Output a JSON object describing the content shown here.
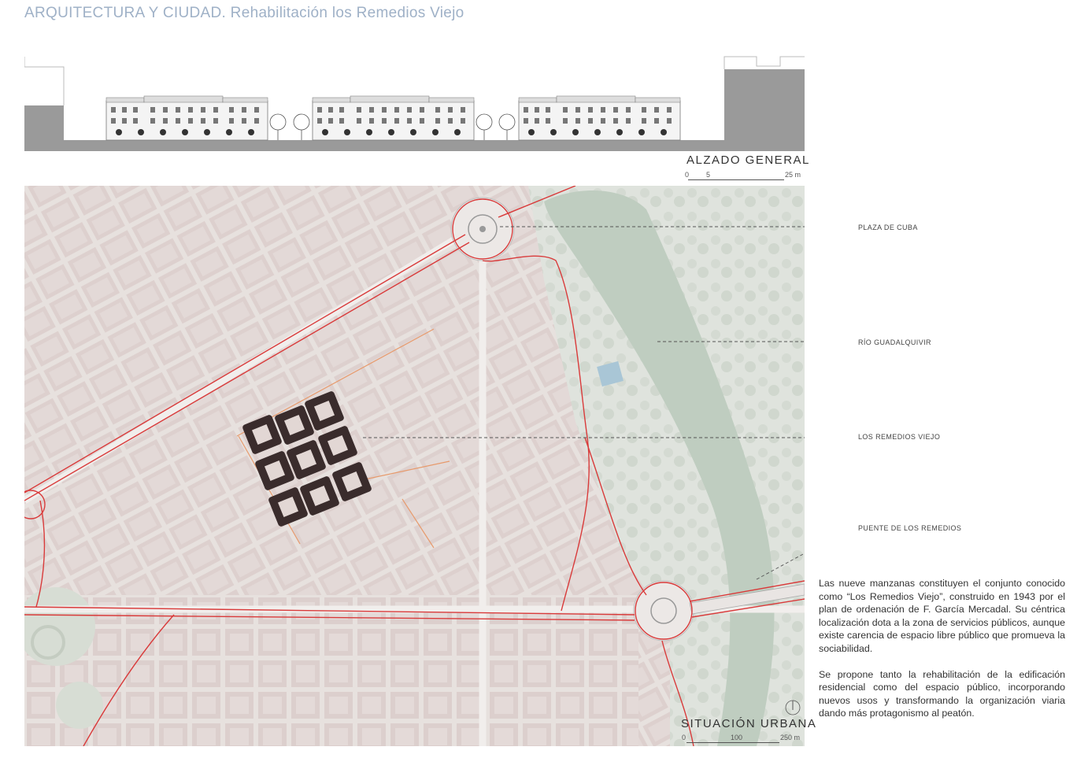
{
  "header": {
    "title": "ARQUITECTURA Y CIUDAD. Rehabilitación los Remedios Viejo"
  },
  "elevation": {
    "caption": "ALZADO GENERAL",
    "scale": {
      "labels": [
        "0",
        "5",
        "25 m"
      ]
    }
  },
  "map": {
    "caption": "SITUACIÓN URBANA",
    "scale": {
      "labels": [
        "0",
        "100",
        "250 m"
      ]
    }
  },
  "labels": {
    "plaza": "PLAZA DE CUBA",
    "rio": "RÍO GUADALQUIVIR",
    "remedios": "LOS REMEDIOS VIEJO",
    "puente": "PUENTE DE LOS REMEDIOS"
  },
  "description": {
    "p1": "Las nueve manzanas constituyen el conjunto conocido como “Los Remedios Viejo”, construido en 1943 por el plan de ordenación de F. García Mercadal. Su céntrica localización dota a la zona de servicios públicos, aunque existe carencia de espacio libre público que promueva la sociabilidad.",
    "p2": "Se propone tanto la rehabilitación de la edificación residencial como del espacio público, incorporando nuevos usos y transformando la organización viaria dando más protagonismo al peatón."
  },
  "colors": {
    "title": "#9fb1c7",
    "road_red": "#d93a3a",
    "block_dark": "#3a2c2c",
    "river": "#bfcdc0",
    "ground_gray": "#9a9a9a"
  },
  "icons": {
    "north": "north-arrow-icon"
  }
}
